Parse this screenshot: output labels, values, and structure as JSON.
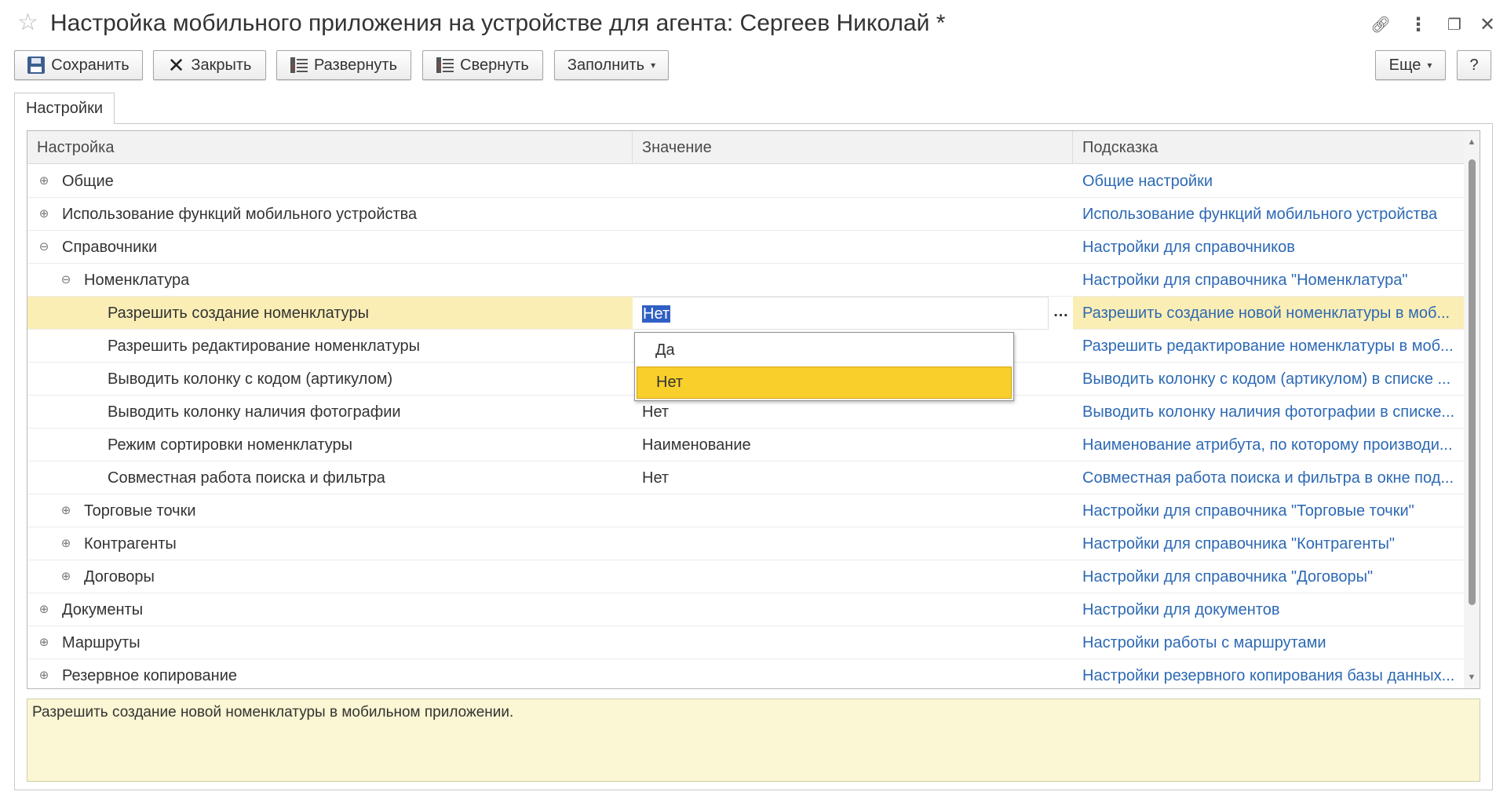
{
  "window": {
    "title": "Настройка мобильного приложения на устройстве для агента: Сергеев Николай *",
    "favorite_icon": "star-icon",
    "controls": [
      "link-icon",
      "more-icon",
      "restore-icon",
      "close-icon"
    ]
  },
  "toolbar": {
    "save_label": "Сохранить",
    "close_label": "Закрыть",
    "expand_label": "Развернуть",
    "collapse_label": "Свернуть",
    "fill_label": "Заполнить",
    "more_label": "Еще",
    "help_label": "?"
  },
  "tabs": [
    {
      "label": "Настройки",
      "active": true
    }
  ],
  "grid": {
    "columns": {
      "setting": "Настройка",
      "value": "Значение",
      "hint": "Подсказка"
    },
    "rows": [
      {
        "name": "Общие",
        "level": 0,
        "expander": "plus",
        "value": "",
        "hint": "Общие настройки"
      },
      {
        "name": "Использование функций мобильного устройства",
        "level": 0,
        "expander": "plus",
        "value": "",
        "hint": "Использование функций мобильного устройства"
      },
      {
        "name": "Справочники",
        "level": 0,
        "expander": "minus",
        "value": "",
        "hint": "Настройки для справочников"
      },
      {
        "name": "Номенклатура",
        "level": 1,
        "expander": "minus",
        "value": "",
        "hint": "Настройки для справочника \"Номенклатура\""
      },
      {
        "name": "Разрешить создание номенклатуры",
        "level": 2,
        "expander": "none",
        "value": "Нет",
        "hint": "Разрешить создание новой номенклатуры в моб...",
        "selected": true
      },
      {
        "name": "Разрешить редактирование номенклатуры",
        "level": 2,
        "expander": "none",
        "value": "",
        "hint": "Разрешить редактирование номенклатуры в моб..."
      },
      {
        "name": "Выводить колонку с кодом (артикулом)",
        "level": 2,
        "expander": "none",
        "value": "",
        "hint": "Выводить колонку с кодом (артикулом) в списке ..."
      },
      {
        "name": "Выводить колонку наличия фотографии",
        "level": 2,
        "expander": "none",
        "value": "Нет",
        "hint": "Выводить колонку наличия фотографии в списке..."
      },
      {
        "name": "Режим сортировки номенклатуры",
        "level": 2,
        "expander": "none",
        "value": "Наименование",
        "hint": "Наименование атрибута, по которому производи..."
      },
      {
        "name": "Совместная работа поиска и фильтра",
        "level": 2,
        "expander": "none",
        "value": "Нет",
        "hint": "Совместная работа поиска и фильтра в окне под..."
      },
      {
        "name": "Торговые точки",
        "level": 1,
        "expander": "plus",
        "value": "",
        "hint": "Настройки для справочника \"Торговые точки\""
      },
      {
        "name": "Контрагенты",
        "level": 1,
        "expander": "plus",
        "value": "",
        "hint": "Настройки для справочника \"Контрагенты\""
      },
      {
        "name": "Договоры",
        "level": 1,
        "expander": "plus",
        "value": "",
        "hint": "Настройки для справочника \"Договоры\""
      },
      {
        "name": "Документы",
        "level": 0,
        "expander": "plus",
        "value": "",
        "hint": "Настройки для документов"
      },
      {
        "name": "Маршруты",
        "level": 0,
        "expander": "plus",
        "value": "",
        "hint": "Настройки работы с маршрутами"
      },
      {
        "name": "Резервное копирование",
        "level": 0,
        "expander": "plus",
        "value": "",
        "hint": "Настройки резервного копирования базы данных..."
      }
    ]
  },
  "dropdown": {
    "options": [
      "Да",
      "Нет"
    ],
    "highlighted": "Нет"
  },
  "description": "Разрешить создание новой номенклатуры в мобильном приложении.",
  "colors": {
    "selected_row": "#fbeeb5",
    "hint_link": "#2d69b4",
    "dropdown_active": "#f9cf2b",
    "description_bg": "#fbf6d3"
  }
}
